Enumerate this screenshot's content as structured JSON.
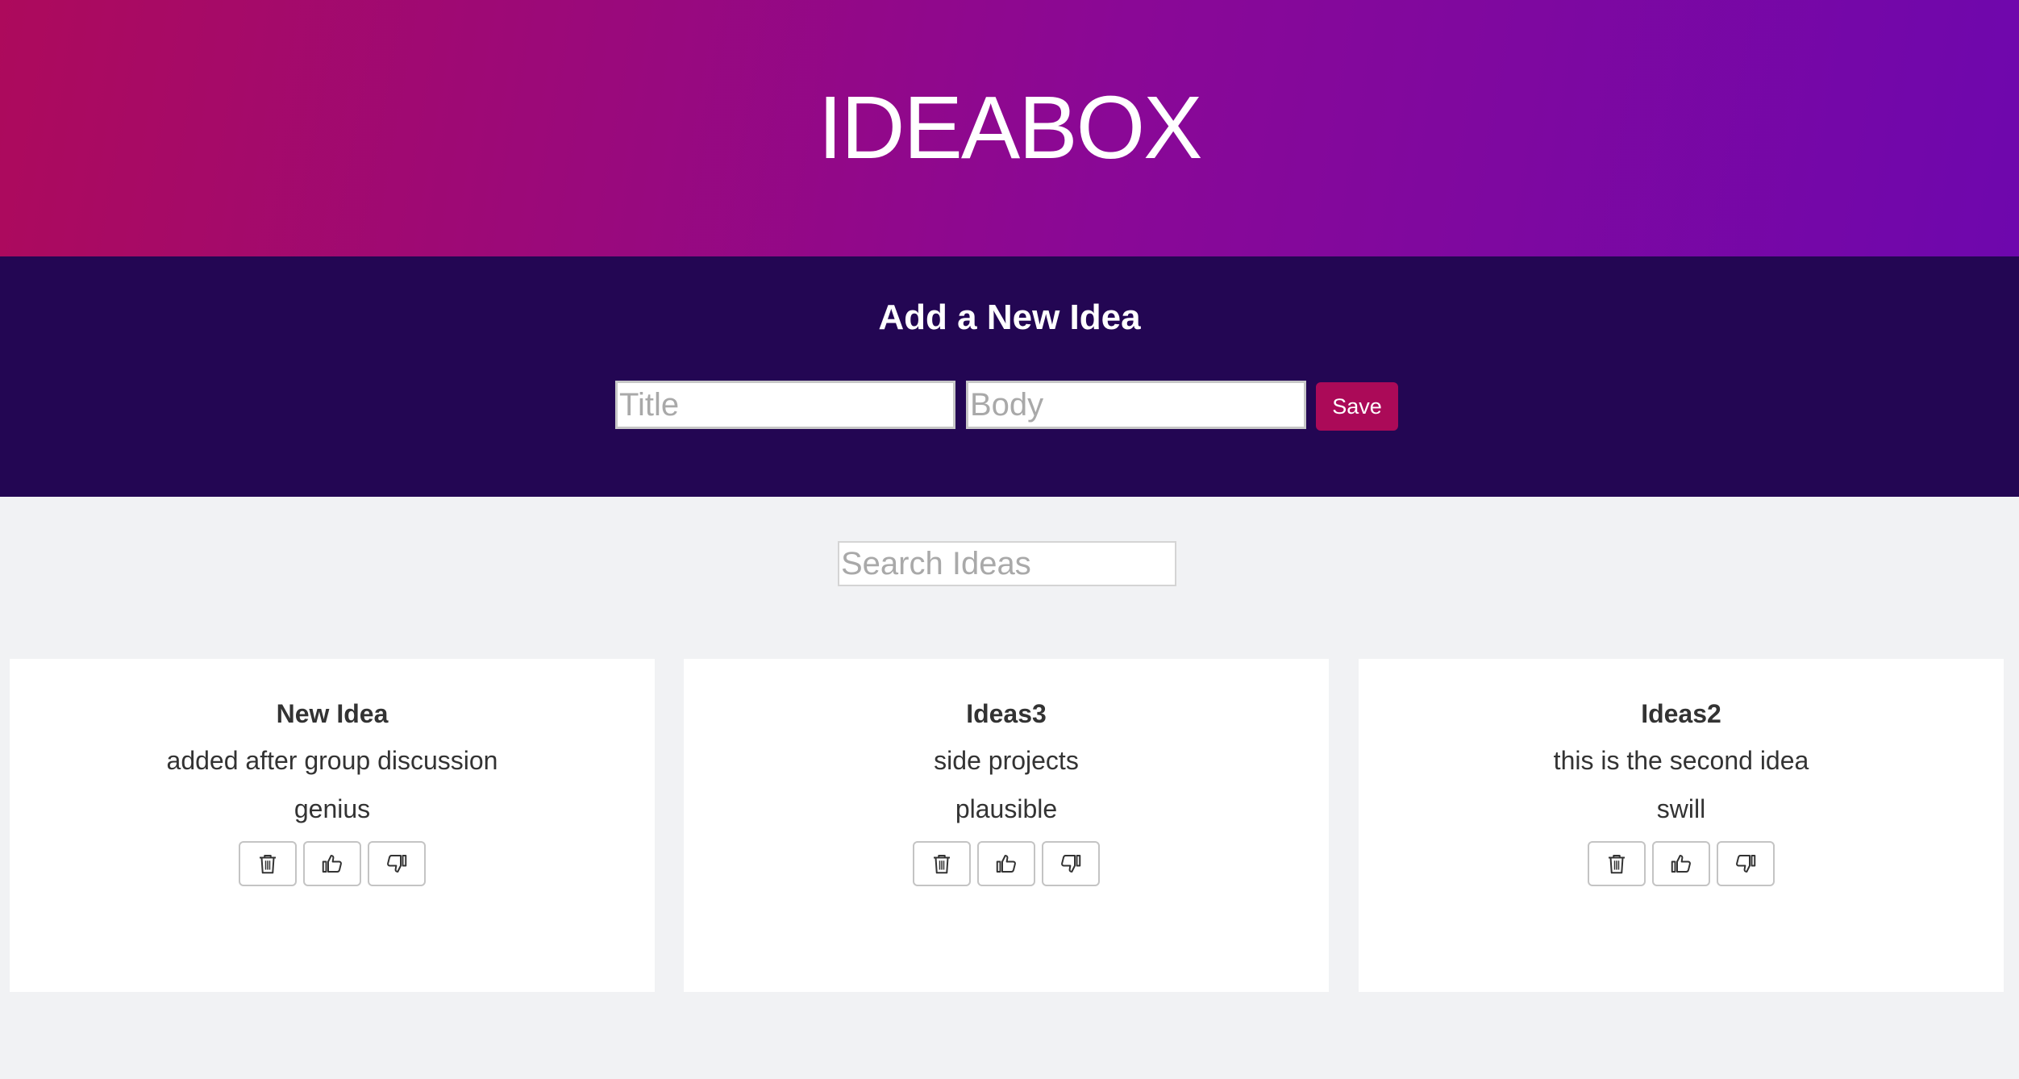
{
  "header": {
    "title": "IDEABOX"
  },
  "form": {
    "heading": "Add a New Idea",
    "title_placeholder": "Title",
    "title_value": "",
    "body_placeholder": "Body",
    "body_value": "",
    "save_label": "Save"
  },
  "search": {
    "placeholder": "Search Ideas",
    "value": ""
  },
  "ideas": [
    {
      "title": "New Idea",
      "body": "added after group discussion",
      "quality": "genius",
      "actions": [
        "trash-icon",
        "thumbs-up-icon",
        "thumbs-down-icon"
      ]
    },
    {
      "title": "Ideas3",
      "body": "side projects",
      "quality": "plausible",
      "actions": [
        "trash-icon",
        "thumbs-up-icon",
        "thumbs-down-icon"
      ]
    },
    {
      "title": "Ideas2",
      "body": "this is the second idea",
      "quality": "swill",
      "actions": [
        "trash-icon",
        "thumbs-up-icon",
        "thumbs-down-icon"
      ]
    }
  ],
  "colors": {
    "header_gradient_start": "#ad0a5c",
    "header_gradient_end": "#6e07ad",
    "form_band": "#230653",
    "save_button": "#ab0a58",
    "page_background": "#f1f2f4",
    "card_background": "#ffffff"
  }
}
